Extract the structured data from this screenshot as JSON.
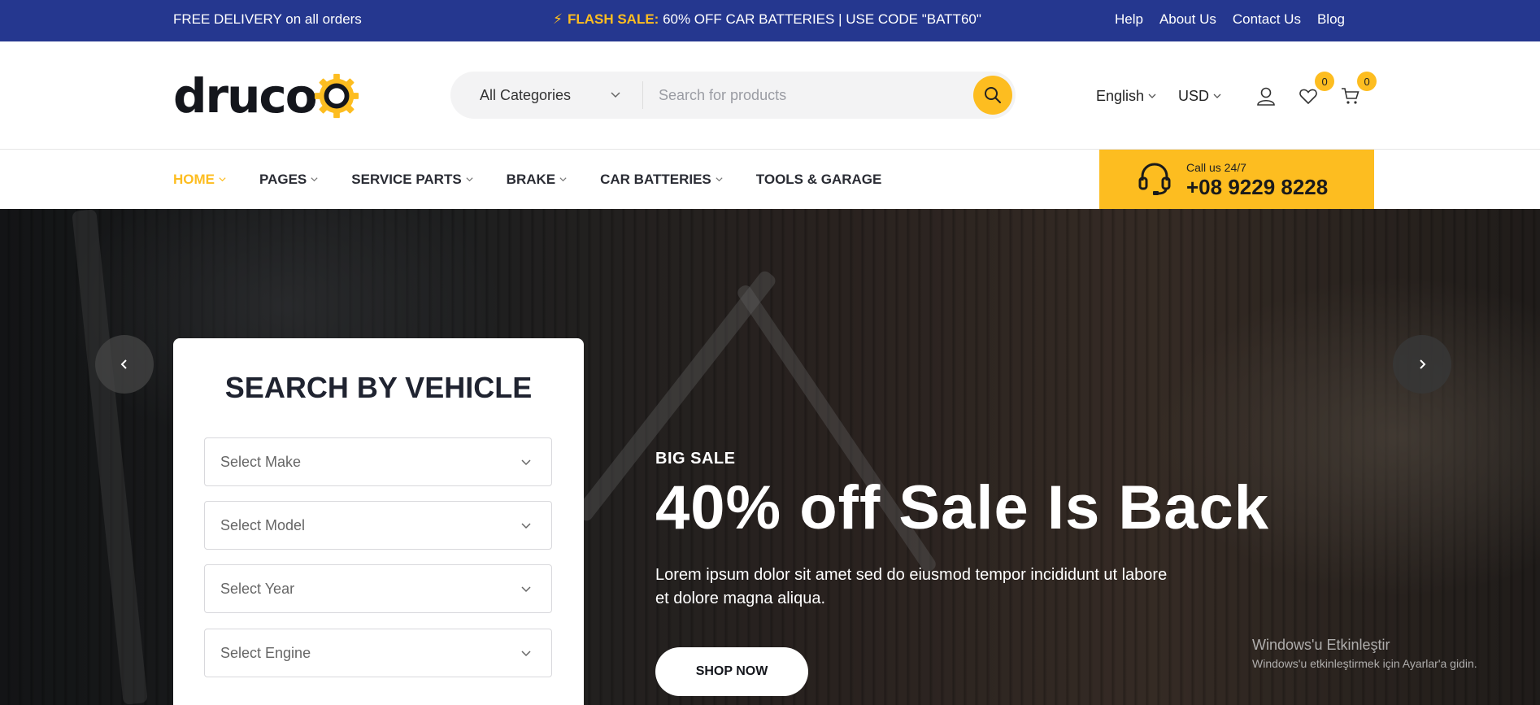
{
  "topbar": {
    "delivery": "FREE DELIVERY on all orders",
    "flash_label": "FLASH SALE:",
    "flash_text": "60% OFF CAR BATTERIES | USE CODE \"BATT60\"",
    "links": [
      "Help",
      "About Us",
      "Contact Us",
      "Blog"
    ],
    "bg_color": "#25378f",
    "accent_color": "#fdbd20"
  },
  "header": {
    "logo": "druco",
    "search": {
      "category": "All Categories",
      "placeholder": "Search for products"
    },
    "language": "English",
    "currency": "USD",
    "wishlist_count": "0",
    "cart_count": "0"
  },
  "nav": {
    "items": [
      "HOME",
      "PAGES",
      "SERVICE PARTS",
      "BRAKE",
      "CAR BATTERIES",
      "TOOLS & GARAGE"
    ],
    "call_label": "Call us 24/7",
    "call_phone": "+08 9229 8228"
  },
  "vehicle_search": {
    "title": "SEARCH BY VEHICLE",
    "selects": [
      "Select Make",
      "Select Model",
      "Select Year",
      "Select Engine"
    ]
  },
  "hero": {
    "kicker": "BIG SALE",
    "headline": "40% off Sale Is Back",
    "body": "Lorem ipsum dolor sit amet sed do eiusmod tempor incididunt ut labore et dolore magna aliqua.",
    "cta": "SHOP NOW"
  },
  "watermark": {
    "line1": "Windows'u Etkinleştir",
    "line2": "Windows'u etkinleştirmek için Ayarlar'a gidin."
  }
}
